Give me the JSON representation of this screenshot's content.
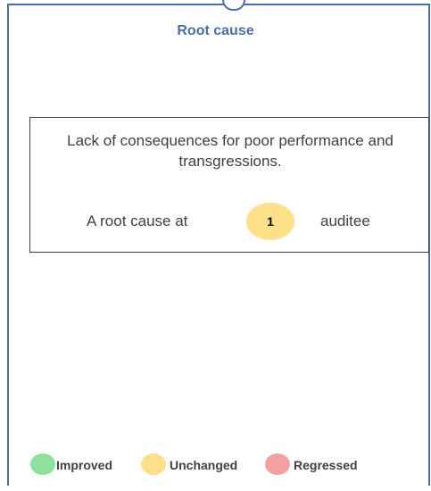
{
  "title": "Root cause",
  "root_cause": {
    "description": "Lack of consequences for poor performance and transgressions.",
    "prefix": "A root cause  at",
    "count": "1",
    "suffix": "auditee",
    "count_color": "#ffe08a"
  },
  "legend": [
    {
      "label": "Improved",
      "color": "#8ee19a"
    },
    {
      "label": "Unchanged",
      "color": "#ffe08a"
    },
    {
      "label": "Regressed",
      "color": "#f4a0a0"
    }
  ],
  "accent_color": "#4a6fa5"
}
